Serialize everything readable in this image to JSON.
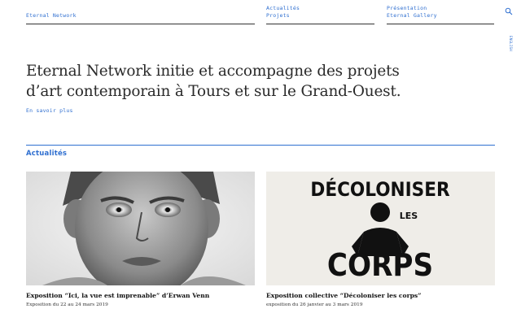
{
  "header": {
    "brand": "Eternal Network",
    "nav_col1": [
      "Actualités",
      "Projets"
    ],
    "nav_col2": [
      "Présentation",
      "Eternal Gallery"
    ],
    "lang_toggle": "ENGLISH"
  },
  "intro": {
    "line1": "Eternal Network initie et accompagne des projets",
    "line2": "d’art contemporain à Tours et sur le Grand-Ouest.",
    "more_link": "En savoir plus"
  },
  "news": {
    "section_title": "Actualités",
    "items": [
      {
        "title": "Exposition “Ici, la vue est imprenable” d’Erwan Venn",
        "date": "Exposition du 22 au 24 mars 2019",
        "image": "charcoal-portrait-child"
      },
      {
        "title": "Exposition collective “Décoloniser les corps”",
        "date": "exposition du 26 janvier au 3 mars 2019",
        "image": "decoloniser-les-corps-poster",
        "poster_text": [
          "DÉCOLONISER",
          "LES",
          "CORPS"
        ]
      }
    ]
  },
  "colors": {
    "accent": "#2f6fd0",
    "text": "#222222",
    "rule": "#333333",
    "poster_bg": "#efede8"
  }
}
